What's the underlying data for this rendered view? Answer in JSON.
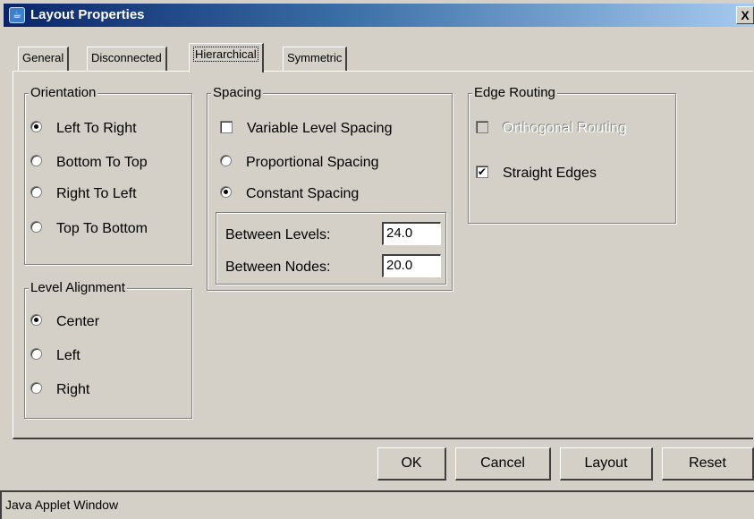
{
  "window": {
    "title": "Layout Properties",
    "icon": "java-applet-icon",
    "close_label": "X"
  },
  "tabs": [
    {
      "label": "General",
      "active": false
    },
    {
      "label": "Disconnected",
      "active": false
    },
    {
      "label": "Hierarchical",
      "active": true
    },
    {
      "label": "Symmetric",
      "active": false
    }
  ],
  "orientation": {
    "title": "Orientation",
    "options": [
      {
        "label": "Left To Right",
        "selected": true
      },
      {
        "label": "Bottom To Top",
        "selected": false
      },
      {
        "label": "Right To Left",
        "selected": false
      },
      {
        "label": "Top To Bottom",
        "selected": false
      }
    ]
  },
  "level_alignment": {
    "title": "Level Alignment",
    "options": [
      {
        "label": "Center",
        "selected": true
      },
      {
        "label": "Left",
        "selected": false
      },
      {
        "label": "Right",
        "selected": false
      }
    ]
  },
  "spacing": {
    "title": "Spacing",
    "variable_level_spacing": {
      "label": "Variable Level Spacing",
      "checked": false
    },
    "proportional": {
      "label": "Proportional Spacing",
      "selected": false
    },
    "constant": {
      "label": "Constant Spacing",
      "selected": true
    },
    "between_levels": {
      "label": "Between Levels:",
      "value": "24.0"
    },
    "between_nodes": {
      "label": "Between Nodes:",
      "value": "20.0"
    }
  },
  "edge_routing": {
    "title": "Edge Routing",
    "orthogonal": {
      "label": "Orthogonal Routing",
      "checked": false,
      "enabled": false
    },
    "straight": {
      "label": "Straight Edges",
      "checked": true,
      "enabled": true
    }
  },
  "buttons": {
    "ok": "OK",
    "cancel": "Cancel",
    "layout": "Layout",
    "reset": "Reset"
  },
  "status": "Java Applet Window"
}
